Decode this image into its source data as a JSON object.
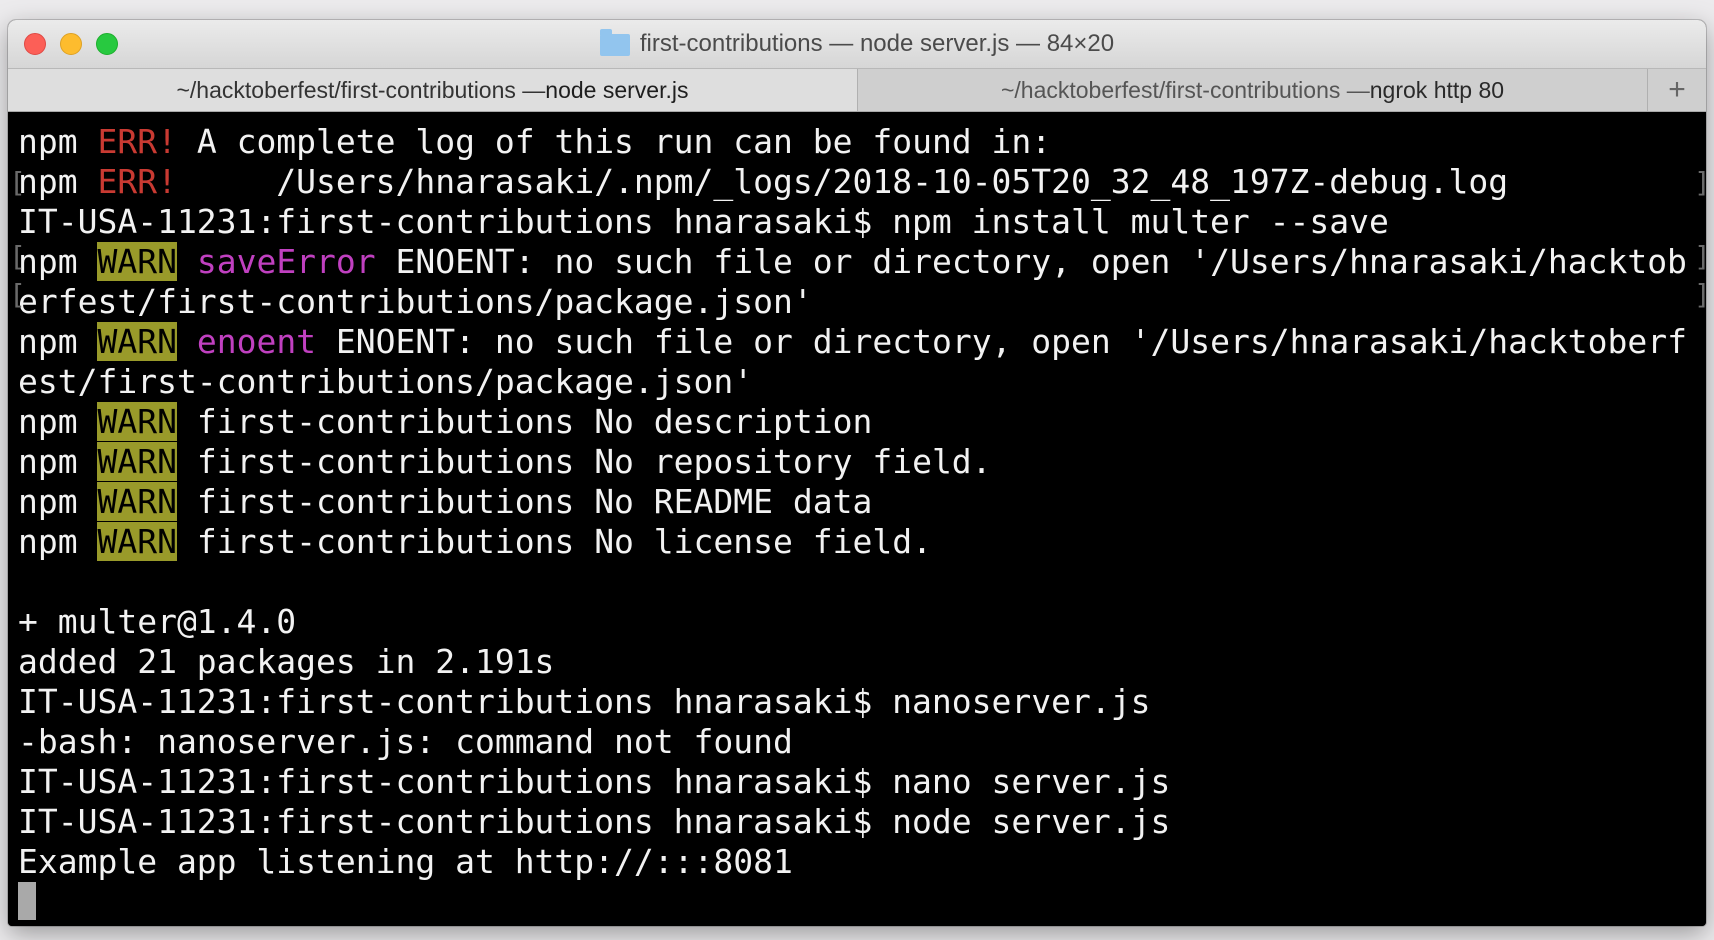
{
  "window": {
    "title": "first-contributions — node server.js — 84×20"
  },
  "tabs": [
    {
      "path": "~/hacktoberfest/first-contributions — ",
      "command": "node server.js"
    },
    {
      "path": "~/hacktoberfest/first-contributions — ",
      "command": "ngrok http 80"
    }
  ],
  "new_tab_label": "+",
  "colors": {
    "err": "#c93a32",
    "warn_bg": "#999a2a",
    "magenta": "#c040c0",
    "text": "#f2f2f2",
    "background": "#000000"
  },
  "terminal": {
    "lines": [
      {
        "segments": [
          {
            "t": "npm "
          },
          {
            "t": "ERR!",
            "c": "err"
          },
          {
            "t": " A complete log of this run can be found in:"
          }
        ]
      },
      {
        "segments": [
          {
            "t": "npm "
          },
          {
            "t": "ERR!",
            "c": "err"
          },
          {
            "t": "     /Users/hnarasaki/.npm/_logs/2018-10-05T20_32_48_197Z-debug.log"
          }
        ]
      },
      {
        "segments": [
          {
            "t": "IT-USA-11231:first-contributions hnarasaki$ npm install multer --save"
          }
        ]
      },
      {
        "segments": [
          {
            "t": "npm "
          },
          {
            "t": "WARN",
            "c": "warn"
          },
          {
            "t": " "
          },
          {
            "t": "saveError",
            "c": "mag"
          },
          {
            "t": " ENOENT: no such file or directory, open '/Users/hnarasaki/hacktob"
          }
        ]
      },
      {
        "segments": [
          {
            "t": "erfest/first-contributions/package.json'"
          }
        ]
      },
      {
        "segments": [
          {
            "t": "npm "
          },
          {
            "t": "WARN",
            "c": "warn"
          },
          {
            "t": " "
          },
          {
            "t": "enoent",
            "c": "mag"
          },
          {
            "t": " ENOENT: no such file or directory, open '/Users/hnarasaki/hacktoberf"
          }
        ]
      },
      {
        "segments": [
          {
            "t": "est/first-contributions/package.json'"
          }
        ]
      },
      {
        "segments": [
          {
            "t": "npm "
          },
          {
            "t": "WARN",
            "c": "warn"
          },
          {
            "t": " first-contributions No description"
          }
        ]
      },
      {
        "segments": [
          {
            "t": "npm "
          },
          {
            "t": "WARN",
            "c": "warn"
          },
          {
            "t": " first-contributions No repository field."
          }
        ]
      },
      {
        "segments": [
          {
            "t": "npm "
          },
          {
            "t": "WARN",
            "c": "warn"
          },
          {
            "t": " first-contributions No README data"
          }
        ]
      },
      {
        "segments": [
          {
            "t": "npm "
          },
          {
            "t": "WARN",
            "c": "warn"
          },
          {
            "t": " first-contributions No license field."
          }
        ]
      },
      {
        "segments": [
          {
            "t": ""
          }
        ]
      },
      {
        "segments": [
          {
            "t": "+ multer@1.4.0"
          }
        ]
      },
      {
        "segments": [
          {
            "t": "added 21 packages in 2.191s"
          }
        ]
      },
      {
        "segments": [
          {
            "t": "IT-USA-11231:first-contributions hnarasaki$ nanoserver.js"
          }
        ]
      },
      {
        "segments": [
          {
            "t": "-bash: nanoserver.js: command not found"
          }
        ]
      },
      {
        "segments": [
          {
            "t": "IT-USA-11231:first-contributions hnarasaki$ nano server.js"
          }
        ]
      },
      {
        "segments": [
          {
            "t": "IT-USA-11231:first-contributions hnarasaki$ node server.js"
          }
        ]
      },
      {
        "segments": [
          {
            "t": "Example app listening at http://:::8081"
          }
        ]
      }
    ]
  }
}
